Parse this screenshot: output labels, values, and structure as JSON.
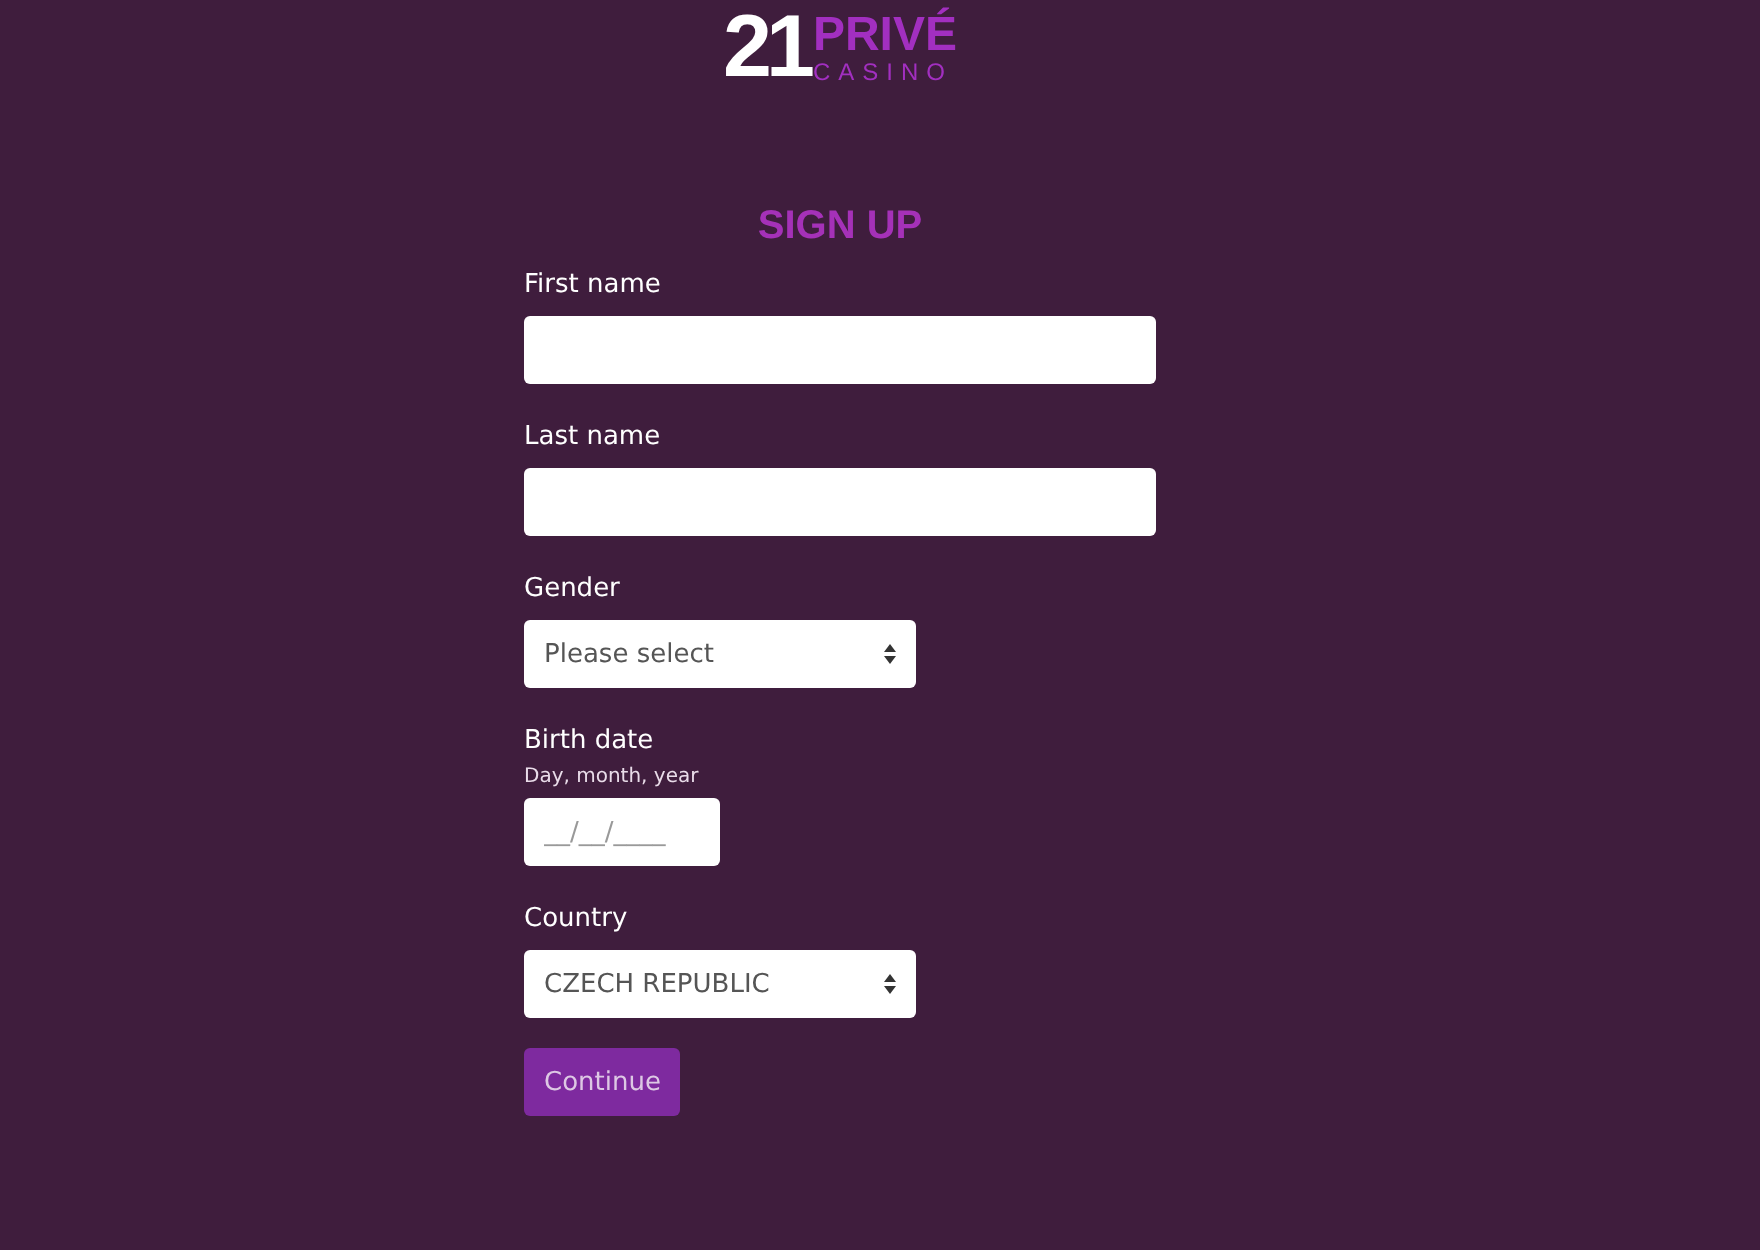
{
  "logo": {
    "number": "21",
    "name": "PRIVÉ",
    "subtitle": "CASINO"
  },
  "title": "SIGN UP",
  "fields": [
    {
      "kind": "text",
      "label": "First name"
    },
    {
      "kind": "text",
      "label": "Last name"
    },
    {
      "kind": "select",
      "label": "Gender",
      "placeholder": "Please select"
    },
    {
      "kind": "date",
      "label": "Birth date",
      "hint": "Day, month, year",
      "placeholder": "__/__/____"
    },
    {
      "kind": "select",
      "label": "Country",
      "value": "CZECH REPUBLIC"
    }
  ],
  "button": "Continue"
}
